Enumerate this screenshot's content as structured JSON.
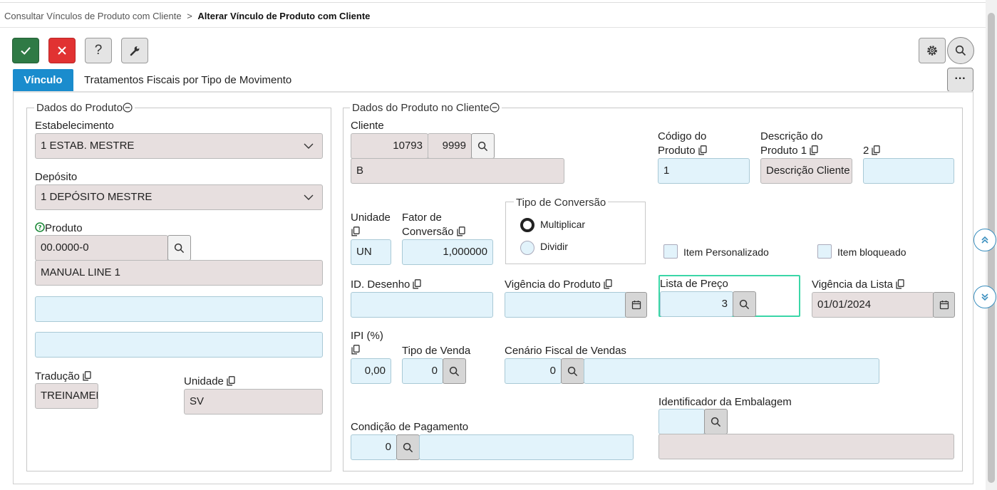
{
  "breadcrumb": {
    "parent": "Consultar Vínculos de Produto com Cliente",
    "separator": ">",
    "current": "Alterar Vínculo de Produto com Cliente"
  },
  "tabs": [
    {
      "label": "Vínculo",
      "active": true
    },
    {
      "label": "Tratamentos Fiscais por Tipo de Movimento",
      "active": false
    }
  ],
  "toolbar": {
    "more_label": "···"
  },
  "dados_produto": {
    "legend": "Dados do Produto",
    "estabelecimento_label": "Estabelecimento",
    "estabelecimento_value": "1 ESTAB. MESTRE",
    "deposito_label": "Depósito",
    "deposito_value": "1 DEPÓSITO MESTRE",
    "produto_label": "Produto",
    "produto_code": "00.0000-0",
    "produto_desc": "MANUAL LINE 1",
    "extra1": "",
    "extra2": "",
    "traducao_label": "Tradução",
    "traducao_value": "TREINAMENTO",
    "unidade_label": "Unidade",
    "unidade_value": "SV"
  },
  "dados_cliente": {
    "legend": "Dados do Produto no Cliente",
    "cliente_label": "Cliente",
    "cliente_code": "10793",
    "cliente_sub": "9999",
    "cliente_nome": "B",
    "codigo_produto_label1": "Código do",
    "codigo_produto_label2": "Produto",
    "codigo_produto_value": "1",
    "descricao1_label1": "Descrição do",
    "descricao1_label2": "Produto 1",
    "descricao1_value": "Descrição Cliente",
    "descricao2_label": "2",
    "descricao2_value": "",
    "unidade_label": "Unidade",
    "unidade_value": "UN",
    "fator_label1": "Fator de",
    "fator_label2": "Conversão",
    "fator_value": "1,000000",
    "tipo_conversao_legend": "Tipo de Conversão",
    "multiplicar_label": "Multiplicar",
    "dividir_label": "Dividir",
    "item_personalizado_label": "Item Personalizado",
    "item_bloqueado_label": "Item bloqueado",
    "id_desenho_label": "ID. Desenho",
    "id_desenho_value": "",
    "vigencia_produto_label": "Vigência do Produto",
    "vigencia_produto_value": "",
    "lista_preco_label": "Lista de Preço",
    "lista_preco_value": "3",
    "vigencia_lista_label": "Vigência da Lista",
    "vigencia_lista_value": "01/01/2024",
    "ipi_label": "IPI (%)",
    "ipi_value": "0,00",
    "tipo_venda_label": "Tipo de Venda",
    "tipo_venda_value": "0",
    "cenario_label": "Cenário Fiscal de Vendas",
    "cenario_value": "0",
    "cenario_desc": "",
    "identificador_label": "Identificador da Embalagem",
    "identificador_value": "",
    "identificador_desc": "",
    "condicao_label": "Condição de Pagamento",
    "condicao_value": "0",
    "condicao_desc": ""
  },
  "colors": {
    "accent": "#1a8ccd",
    "confirm": "#2f7a45",
    "cancel": "#e13232",
    "readonly_bg": "#e7dfdf",
    "editable_bg": "#e2f3fb",
    "focus_border": "#3bd6a7"
  },
  "icons": [
    "check-icon",
    "close-icon",
    "help-icon",
    "wrench-icon",
    "gear-icon",
    "search-icon",
    "chevron-down-icon",
    "copy-icon",
    "calendar-icon",
    "collapse-icon",
    "scroll-up-icon",
    "scroll-down-icon"
  ]
}
